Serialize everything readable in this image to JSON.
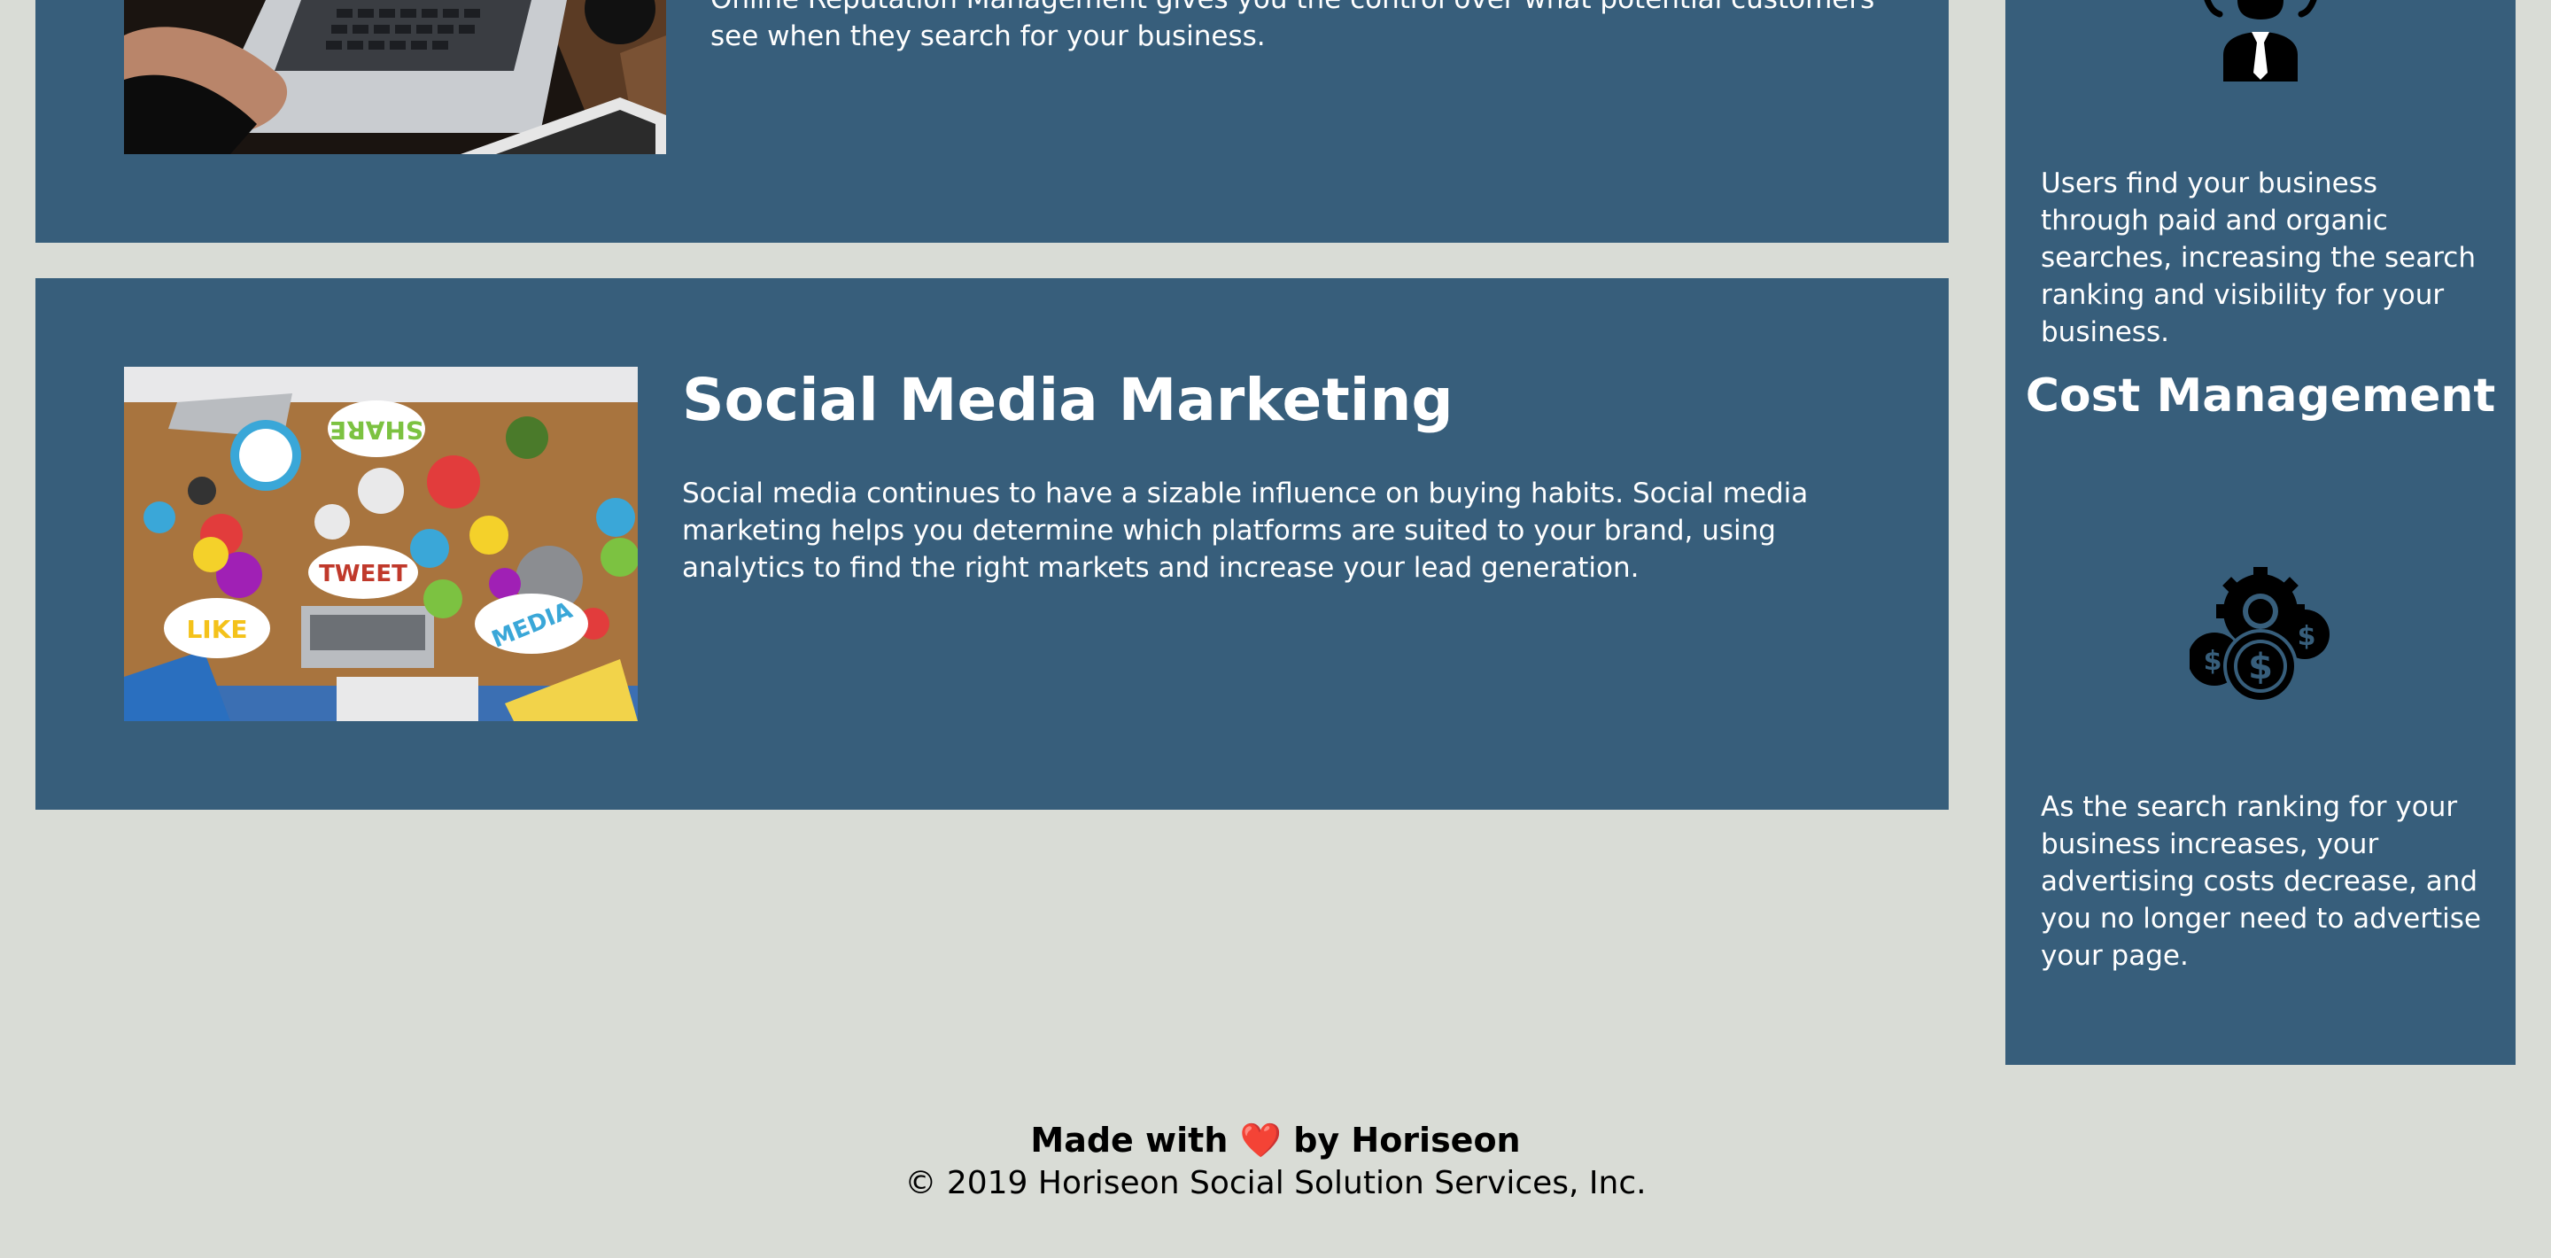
{
  "services": {
    "reputation": {
      "text": "Online Reputation Management gives you the control over what potential customers see when they search for your business."
    },
    "social": {
      "title": "Social Media Marketing",
      "text": "Social media continues to have a sizable influence on buying habits. Social media marketing helps you determine which platforms are suited to your brand, using analytics to find the right markets and increase your lead generation.",
      "image_words": [
        "SHARE",
        "TWEET",
        "LIKE",
        "MEDIA"
      ]
    }
  },
  "benefits": {
    "lead_text": "Users find your business through paid and organic searches, increasing the search ranking and visibility for your business.",
    "cost_title": "Cost Management",
    "cost_text": "As the search ranking for your business increases, your advertising costs decrease, and you no longer need to advertise your page.",
    "icons": [
      "lead-generation-icon",
      "cost-management-icon"
    ]
  },
  "footer": {
    "made_prefix": "Made with",
    "heart": "❤️",
    "made_suffix": "by Horiseon",
    "copyright": "© 2019 Horiseon Social Solution Services, Inc."
  },
  "colors": {
    "background": "#d9dcd6",
    "card": "#375e7b",
    "text": "#ffffff",
    "heart": "#e0202a"
  }
}
